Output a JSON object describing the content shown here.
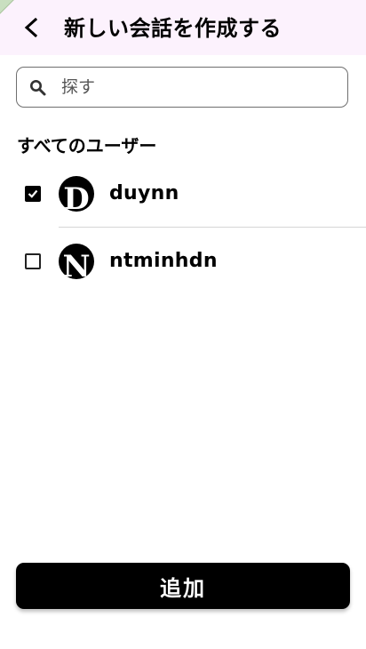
{
  "header": {
    "title": "新しい会話を作成する",
    "back_icon": "chevron-left-icon",
    "background": "#fcf2fd"
  },
  "search": {
    "placeholder": "探す",
    "value": "",
    "icon": "search-icon"
  },
  "section": {
    "title": "すべてのユーザー"
  },
  "users": [
    {
      "name": "duynn",
      "avatar_letter": "D",
      "checked": true
    },
    {
      "name": "ntminhdn",
      "avatar_letter": "N",
      "checked": false
    }
  ],
  "actions": {
    "add_label": "追加"
  },
  "colors": {
    "primary": "#000000",
    "on_primary": "#ffffff"
  }
}
